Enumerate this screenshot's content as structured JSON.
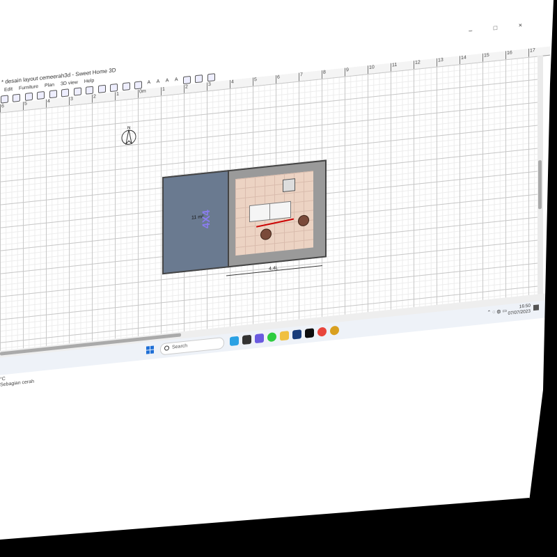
{
  "window": {
    "title": "* desain layout cemeerah3d - Sweet Home 3D",
    "controls": [
      "–",
      "□",
      "×"
    ]
  },
  "menubar": {
    "items": [
      "Edit",
      "Furniture",
      "Plan",
      "3D view",
      "Help"
    ]
  },
  "toolbar": {
    "icons": [
      "new-icon",
      "open-icon",
      "save-icon",
      "cut-icon",
      "undo-icon",
      "redo-icon",
      "select-icon",
      "pan-icon",
      "create-walls-icon",
      "create-rooms-icon",
      "create-dimensions-icon",
      "add-text-icon",
      "zoom-in-icon",
      "zoom-out-icon",
      "camera-icon"
    ],
    "text_sizes": [
      "A",
      "A",
      "A",
      "A"
    ]
  },
  "ruler": {
    "ticks": [
      "6",
      "5",
      "4",
      "3",
      "2",
      "1",
      "0m",
      "1",
      "2",
      "3",
      "4",
      "5",
      "6",
      "7",
      "8",
      "9",
      "10",
      "11",
      "12",
      "13",
      "14",
      "15",
      "16",
      "17"
    ]
  },
  "plan": {
    "compass_label": "N",
    "left_room": {
      "area": "11 m²",
      "label": "4X4"
    },
    "dimension_label": "4,4L"
  },
  "status": {
    "temperature": "°C",
    "weather": "Sebagian cerah"
  },
  "taskbar": {
    "search_placeholder": "Search",
    "apps": [
      "bing-icon",
      "file-explorer-icon",
      "zoom-icon",
      "whatsapp-icon",
      "folder-icon",
      "store-icon",
      "dropbox-icon",
      "chrome-icon",
      "chrome-alt-icon"
    ],
    "time": "16:50",
    "date": "07/07/2023"
  },
  "colors": {
    "left_room": "#6a7a90",
    "right_room_wall": "#9a9a9a",
    "floor": "#ecd3c3",
    "label_purple": "#8a7cf0",
    "windows_blue": "#1f6fd6"
  }
}
